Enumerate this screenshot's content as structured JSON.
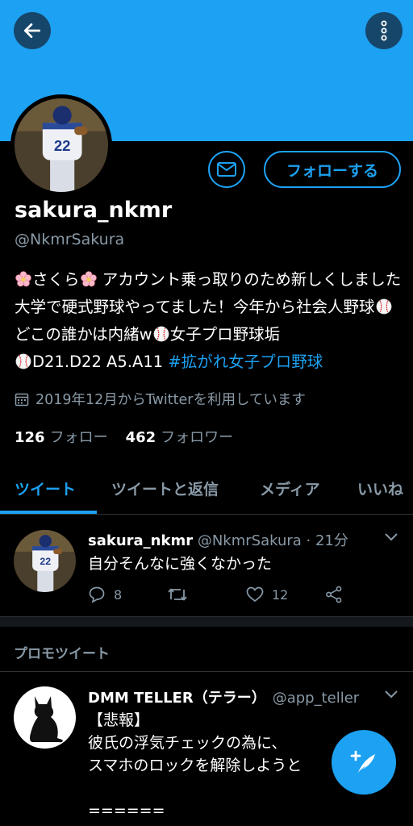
{
  "colors": {
    "accent": "#1da1f2",
    "muted": "#8899a6",
    "background": "#000000"
  },
  "profile": {
    "display_name": "sakura_nkmr",
    "handle": "@NkmrSakura",
    "follow_label": "フォローする",
    "bio": {
      "p1": "さくら",
      "p2": " アカウント乗っ取りのため新しくしました 大学で硬式野球やってました！今年から社会人野球",
      "p3": "どこの誰かは内緒w",
      "p4": "女子プロ野球垢",
      "p5": "D21.D22 A5.A11 ",
      "hashtag": "#拡がれ女子プロ野球"
    },
    "joined": "2019年12月からTwitterを利用しています",
    "following_count": "126",
    "following_label": "フォロー",
    "followers_count": "462",
    "followers_label": "フォロワー"
  },
  "tabs": [
    "ツイート",
    "ツイートと返信",
    "メディア",
    "いいね"
  ],
  "tweet": {
    "name": "sakura_nkmr",
    "meta": "@NkmrSakura · 21分",
    "text": "自分そんなに強くなかった",
    "reply_count": "8",
    "like_count": "12"
  },
  "promo_label": "プロモツイート",
  "ad": {
    "name": "DMM TELLER（テラー）",
    "handle": "@app_teller",
    "body": "【悲報】\n彼氏の浮気チェックの為に、\nスマホのロックを解除しようと\n\n======"
  },
  "icons": [
    "back-arrow-icon",
    "more-vertical-icon",
    "mail-icon",
    "calendar-icon",
    "reply-icon",
    "retweet-icon",
    "like-icon",
    "share-icon",
    "chevron-down-icon",
    "compose-icon",
    "cat-icon",
    "sakura-icon",
    "baseball-icon"
  ]
}
